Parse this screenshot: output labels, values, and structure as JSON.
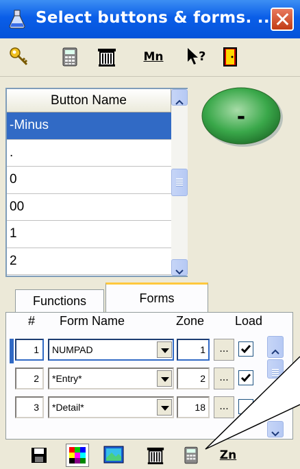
{
  "window": {
    "title": "Select buttons & forms. ..."
  },
  "toolbar": {
    "mn_label": "Mn"
  },
  "button_list": {
    "header": "Button Name",
    "items": [
      "-Minus",
      ".",
      "0",
      "00",
      "1",
      "2"
    ],
    "selected": "-Minus"
  },
  "preview": {
    "label": "-",
    "color": "#3aa84a"
  },
  "tabs": [
    "Functions",
    "Forms"
  ],
  "active_tab": "Forms",
  "forms_table": {
    "headers": {
      "num": "#",
      "name": "Form Name",
      "zone": "Zone",
      "load": "Load"
    },
    "rows": [
      {
        "num": "1",
        "name": "NUMPAD",
        "zone": "1",
        "dots": "...",
        "load": true
      },
      {
        "num": "2",
        "name": "*Entry*",
        "zone": "2",
        "dots": "...",
        "load": true
      },
      {
        "num": "3",
        "name": "*Detail*",
        "zone": "18",
        "dots": "...",
        "load": false
      }
    ]
  },
  "bottom_toolbar": {
    "zn_label": "Zn"
  }
}
